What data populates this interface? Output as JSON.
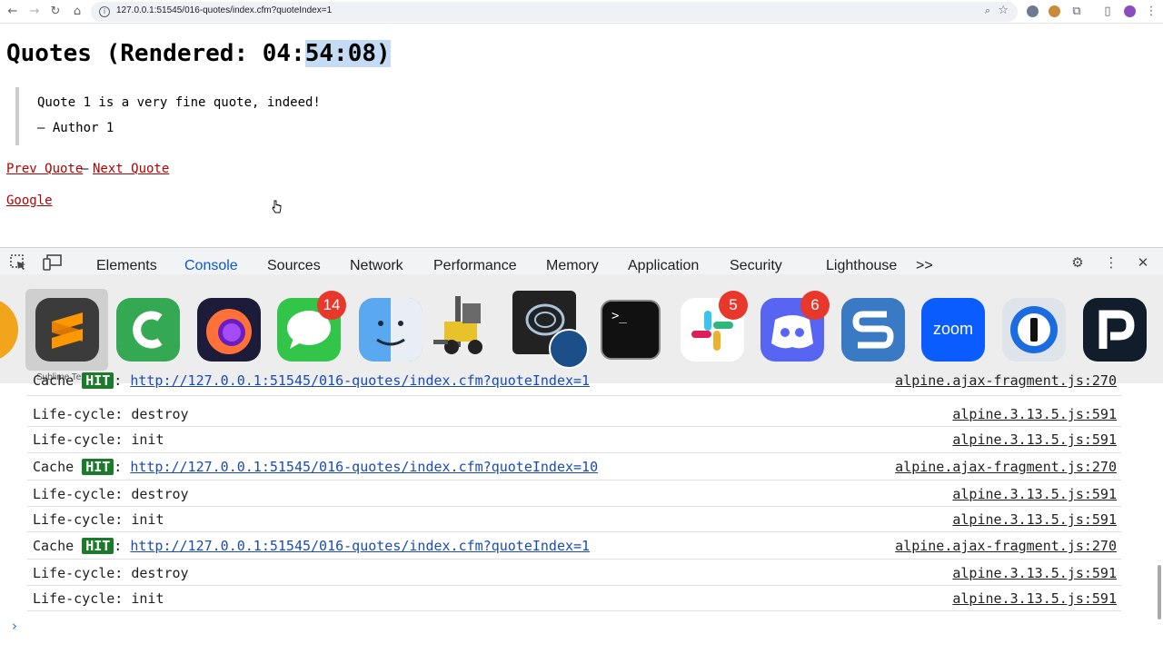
{
  "browser": {
    "url": "127.0.0.1:51545/016-quotes/index.cfm?quoteIndex=1"
  },
  "page": {
    "title_prefix": "Quotes (Rendered: 04:",
    "title_selected": "54:08)",
    "quote_text": "Quote 1 is a very fine quote, indeed!",
    "quote_author": "— Author 1",
    "prev_link": "Prev Quote",
    "separator": "–",
    "next_link": "Next Quote",
    "google_link": "Google"
  },
  "devtools": {
    "tabs": [
      "Elements",
      "Console",
      "Sources",
      "Network",
      "Performance",
      "Memory",
      "Application",
      "Security",
      "Lighthouse"
    ],
    "active_tab": "Console",
    "more": ">>"
  },
  "dock": {
    "hover_label": "Sublime Text",
    "badges": {
      "messages": "14",
      "slack": "5",
      "discord": "6"
    },
    "zoom_label": "zoom",
    "terminal_prompt": ">_"
  },
  "console": {
    "rows": [
      {
        "type": "cache",
        "prefix": "Cache ",
        "badge": "HIT",
        "sep": ":",
        "url": "http://127.0.0.1:51545/016-quotes/index.cfm?quoteIndex=1",
        "source": "alpine.ajax-fragment.js:270"
      },
      {
        "type": "text",
        "text": "Life-cycle: destroy",
        "source": "alpine.3.13.5.js:591"
      },
      {
        "type": "text",
        "text": "Life-cycle: init",
        "source": "alpine.3.13.5.js:591"
      },
      {
        "type": "cache",
        "prefix": "Cache ",
        "badge": "HIT",
        "sep": ":",
        "url": "http://127.0.0.1:51545/016-quotes/index.cfm?quoteIndex=10",
        "source": "alpine.ajax-fragment.js:270"
      },
      {
        "type": "text",
        "text": "Life-cycle: destroy",
        "source": "alpine.3.13.5.js:591"
      },
      {
        "type": "text",
        "text": "Life-cycle: init",
        "source": "alpine.3.13.5.js:591"
      },
      {
        "type": "cache",
        "prefix": "Cache ",
        "badge": "HIT",
        "sep": ":",
        "url": "http://127.0.0.1:51545/016-quotes/index.cfm?quoteIndex=1",
        "source": "alpine.ajax-fragment.js:270"
      },
      {
        "type": "text",
        "text": "Life-cycle: destroy",
        "source": "alpine.3.13.5.js:591"
      },
      {
        "type": "text",
        "text": "Life-cycle: init",
        "source": "alpine.3.13.5.js:591"
      }
    ],
    "prompt": "›"
  }
}
